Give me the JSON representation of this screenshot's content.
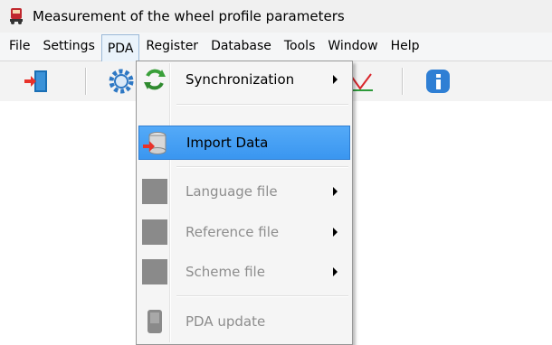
{
  "window": {
    "title": "Measurement of the wheel profile parameters",
    "icon": "train-icon"
  },
  "menubar": {
    "items": [
      "File",
      "Settings",
      "PDA",
      "Register",
      "Database",
      "Tools",
      "Window",
      "Help"
    ],
    "open": "PDA"
  },
  "toolbar": {
    "buttons": [
      "exit-door-icon",
      "gear-icon",
      "chart-icon",
      "info-icon"
    ]
  },
  "pda_menu": {
    "items": [
      {
        "label": "Synchronization",
        "icon": "sync-arrows-icon",
        "submenu": true,
        "enabled": true
      },
      {
        "label": "Import Data",
        "icon": "database-import-icon",
        "submenu": false,
        "enabled": true,
        "highlighted": true
      },
      {
        "label": "Language file",
        "icon": "file-icon",
        "submenu": true,
        "enabled": false
      },
      {
        "label": "Reference file",
        "icon": "file-icon",
        "submenu": true,
        "enabled": false
      },
      {
        "label": "Scheme file",
        "icon": "file-icon",
        "submenu": true,
        "enabled": false
      },
      {
        "label": "PDA update",
        "icon": "pda-icon",
        "submenu": false,
        "enabled": false
      }
    ]
  },
  "colors": {
    "highlight": "#3d9cf5",
    "disabled_text": "#8d8d8d"
  }
}
